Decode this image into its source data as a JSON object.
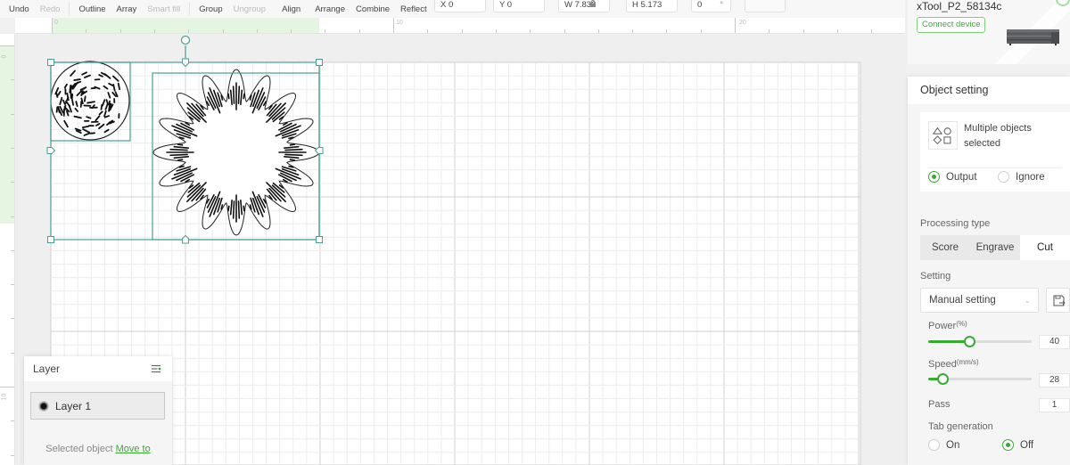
{
  "toolbar": {
    "buttons": [
      {
        "label": "Undo",
        "enabled": true
      },
      {
        "label": "Redo",
        "enabled": false
      },
      {
        "label": "Outline",
        "enabled": true
      },
      {
        "label": "Array",
        "enabled": true
      },
      {
        "label": "Smart fill",
        "enabled": false
      },
      {
        "label": "Group",
        "enabled": true
      },
      {
        "label": "Ungroup",
        "enabled": false
      },
      {
        "label": "Align",
        "enabled": true
      },
      {
        "label": "Arrange",
        "enabled": true
      },
      {
        "label": "Combine",
        "enabled": true
      },
      {
        "label": "Reflect",
        "enabled": true
      }
    ],
    "x_field": "X 0",
    "y_field": "Y 0",
    "w_field": "W 7.832",
    "h_field": "H 5.173",
    "rotation_field": "0",
    "rotation_unit": "°",
    "lock_icon": "lock-icon"
  },
  "rulers": {
    "top_labels": [
      "0",
      "10",
      "20"
    ],
    "left_labels": [
      "0",
      "10"
    ]
  },
  "canvas": {
    "selection_color": "#4a9e93",
    "objects": [
      "dotted-circle",
      "flower-16-petals"
    ]
  },
  "layer_panel": {
    "title": "Layer",
    "menu_icon": "list-settings-icon",
    "layers": [
      {
        "name": "Layer 1",
        "selected": true
      }
    ],
    "footer_text": "Selected object",
    "footer_link": "Move to"
  },
  "device": {
    "name": "xTool_P2_58134c",
    "connect_label": "Connect device",
    "image": "laser-machine-image"
  },
  "object_setting": {
    "title": "Object setting",
    "selection_text_line1": "Multiple objects",
    "selection_text_line2": "selected",
    "selection_icon": "shapes-icon",
    "output_options": [
      {
        "label": "Output",
        "checked": true
      },
      {
        "label": "Ignore",
        "checked": false
      }
    ],
    "processing_type_label": "Processing type",
    "processing_types": [
      {
        "label": "Score",
        "active": false
      },
      {
        "label": "Engrave",
        "active": false
      },
      {
        "label": "Cut",
        "active": true
      }
    ],
    "setting_label": "Setting",
    "setting_value": "Manual setting",
    "power_label": "Power",
    "power_unit": "(%)",
    "power_value": "40",
    "power_fraction": 0.4,
    "speed_label": "Speed",
    "speed_unit": "(mm/s)",
    "speed_value": "28",
    "speed_fraction": 0.14,
    "pass_label": "Pass",
    "pass_value": "1",
    "tab_generation_label": "Tab generation",
    "tab_options": [
      {
        "label": "On",
        "checked": false
      },
      {
        "label": "Off",
        "checked": true
      }
    ]
  },
  "colors": {
    "accent": "#3aa935",
    "selection": "#4a9e93",
    "highlight": "#e6f5e2"
  }
}
